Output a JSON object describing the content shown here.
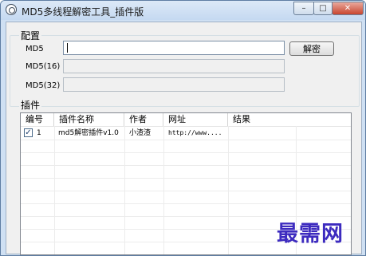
{
  "window": {
    "title": "MD5多线程解密工具_插件版",
    "controls": {
      "minimize": "–",
      "maximize": "□",
      "close": "✕"
    }
  },
  "config": {
    "group_label": "配置",
    "md5_label": "MD5",
    "md5_value": "",
    "md5_16_label": "MD5(16)",
    "md5_16_value": "",
    "md5_32_label": "MD5(32)",
    "md5_32_value": "",
    "decrypt_button": "解密"
  },
  "plugins": {
    "group_label": "插件",
    "columns": [
      "编号",
      "插件名称",
      "作者",
      "网址",
      "结果"
    ],
    "rows": [
      {
        "checked": true,
        "id": "1",
        "name": "md5解密插件v1.0",
        "author": "小渣渣",
        "url": "http://www....",
        "result": ""
      }
    ]
  },
  "watermark": "最需网",
  "icons": {
    "app": "app-circle-icon",
    "check": "checkbox-check-icon"
  }
}
